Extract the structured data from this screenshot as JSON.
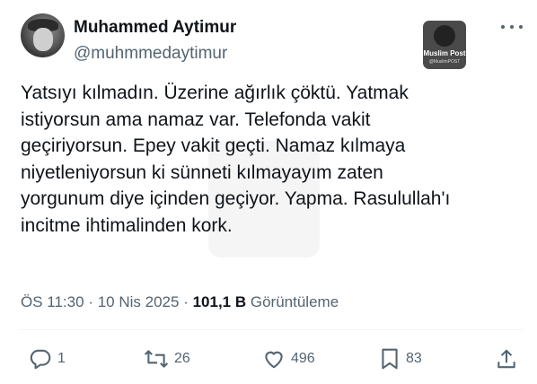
{
  "author": {
    "name": "Muhammed Aytimur",
    "handle": "@muhmmedaytimur"
  },
  "watermark": {
    "title": "Muslim Post",
    "subtitle": "@MuslimPOST"
  },
  "tweet": {
    "lines": [
      "Yatsıyı kılmadın. Üzerine ağırlık çöktü. Yatmak",
      "istiyorsun ama namaz var. Telefonda vakit",
      "geçiriyorsun. Epey vakit geçti. Namaz kılmaya",
      "niyetleniyorsun ki sünneti kılmayayım zaten",
      "yorgunum diye içinden geçiyor. Yapma. Rasulullah'ı",
      "incitme ihtimalinden kork."
    ]
  },
  "meta": {
    "time": "ÖS 11:30",
    "separator": "·",
    "date": "10 Nis 2025",
    "views_count": "101,1 B",
    "views_label": "Görüntüleme"
  },
  "actions": {
    "reply_count": "1",
    "retweet_count": "26",
    "like_count": "496",
    "bookmark_count": "83"
  },
  "icons": [
    "more-icon",
    "reply-icon",
    "retweet-icon",
    "like-icon",
    "bookmark-icon",
    "share-icon"
  ],
  "colors": {
    "text": "#0f1419",
    "secondary": "#536471",
    "divider": "#eff3f4"
  }
}
